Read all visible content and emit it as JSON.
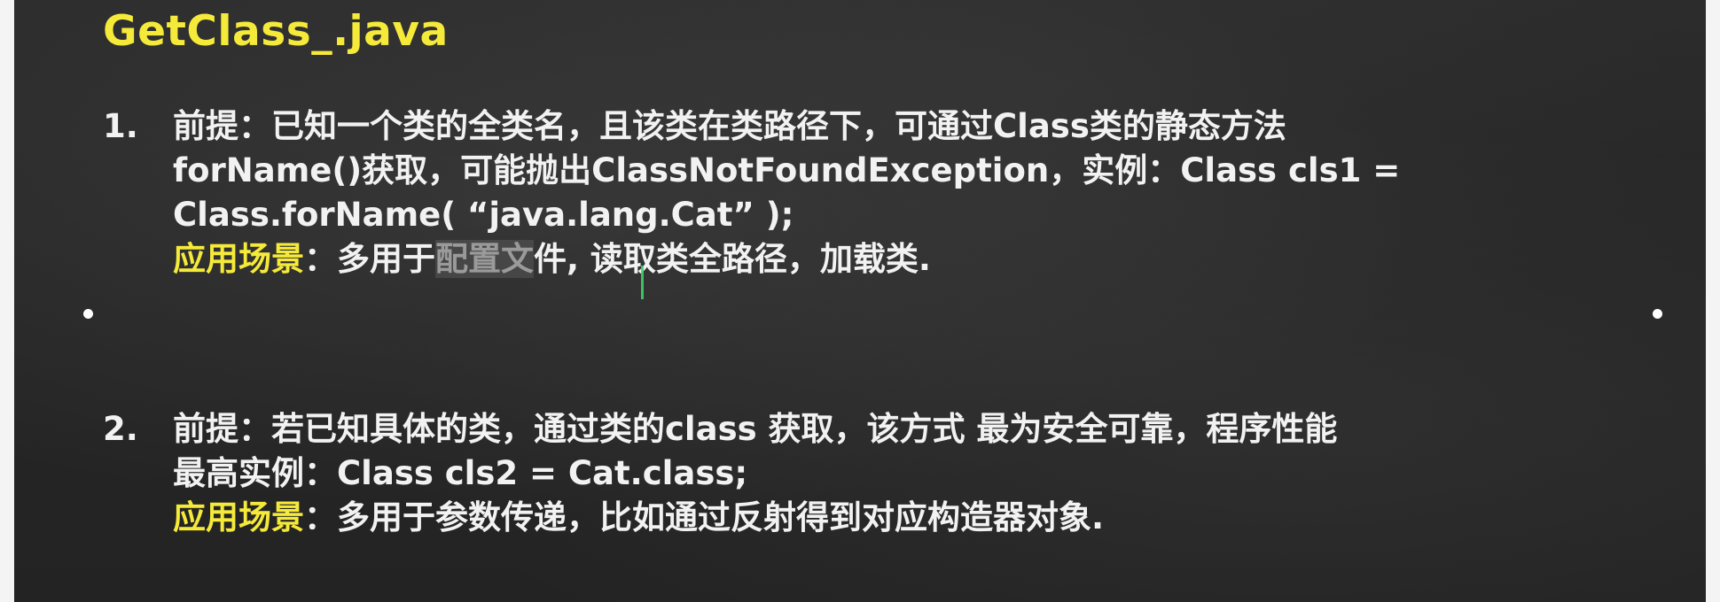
{
  "title": "GetClass_.java",
  "items": [
    {
      "number": "1.",
      "lines": [
        "前提：已知一个类的全类名，且该类在类路径下，可通过Class类的静态方法",
        "forName()获取，可能抛出ClassNotFoundException，实例：Class cls1 =",
        "Class.forName( “java.lang.Cat” );"
      ],
      "scene_label": "应用场景",
      "scene_sep": "：",
      "scene_pre": "多用于",
      "scene_selected": "配置文",
      "scene_post": "件, 读取类全路径，加载类."
    },
    {
      "number": "2.",
      "lines": [
        "前提：若已知具体的类，通过类的class 获取，该方式 最为安全可靠，程序性能",
        "最高实例：Class cls2 = Cat.class;"
      ],
      "scene_label": "应用场景",
      "scene_sep": "：",
      "scene_text": "多用于参数传递，比如通过反射得到对应构造器对象."
    }
  ]
}
